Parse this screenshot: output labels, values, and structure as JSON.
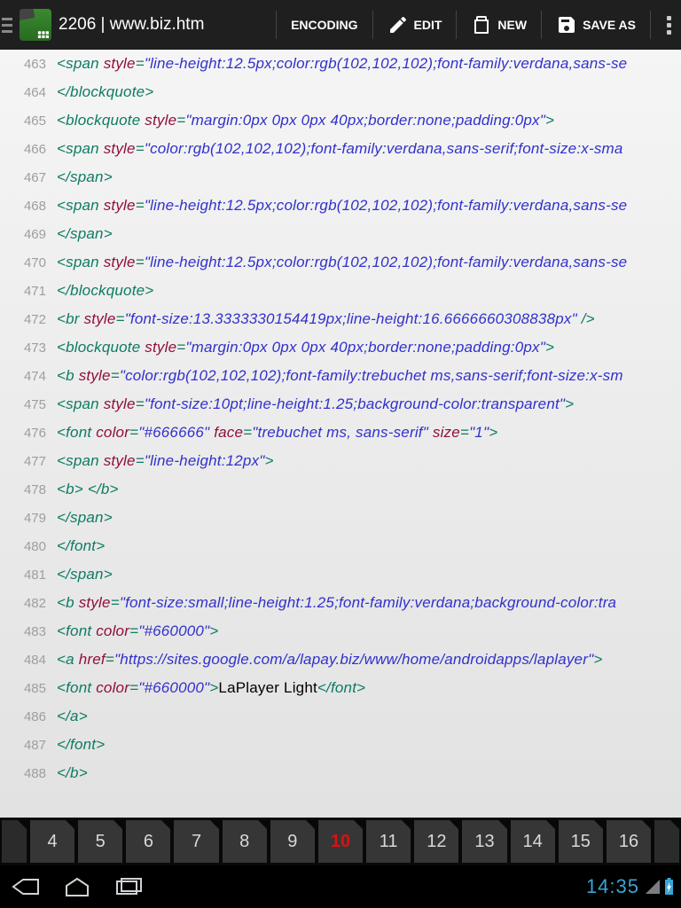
{
  "header": {
    "title": "2206 | www.biz.htm",
    "encoding": "ENCODING",
    "edit": "EDIT",
    "new": "NEW",
    "saveas": "SAVE AS"
  },
  "lines": [
    {
      "n": "463",
      "tokens": [
        {
          "c": "tag",
          "t": "<span "
        },
        {
          "c": "attr",
          "t": "style"
        },
        {
          "c": "tag",
          "t": "="
        },
        {
          "c": "val",
          "t": "\"line-height:12.5px;color:rgb(102,102,102);font-family:verdana,sans-se"
        }
      ]
    },
    {
      "n": "464",
      "tokens": [
        {
          "c": "tag",
          "t": "</blockquote>"
        }
      ]
    },
    {
      "n": "465",
      "tokens": [
        {
          "c": "tag",
          "t": "<blockquote "
        },
        {
          "c": "attr",
          "t": "style"
        },
        {
          "c": "tag",
          "t": "="
        },
        {
          "c": "val",
          "t": "\"margin:0px 0px 0px 40px;border:none;padding:0px\""
        },
        {
          "c": "tag",
          "t": ">"
        }
      ]
    },
    {
      "n": "466",
      "tokens": [
        {
          "c": "tag",
          "t": "<span "
        },
        {
          "c": "attr",
          "t": "style"
        },
        {
          "c": "tag",
          "t": "="
        },
        {
          "c": "val",
          "t": "\"color:rgb(102,102,102);font-family:verdana,sans-serif;font-size:x-sma"
        }
      ]
    },
    {
      "n": "467",
      "tokens": [
        {
          "c": "tag",
          "t": "</span>"
        }
      ]
    },
    {
      "n": "468",
      "tokens": [
        {
          "c": "tag",
          "t": "<span "
        },
        {
          "c": "attr",
          "t": "style"
        },
        {
          "c": "tag",
          "t": "="
        },
        {
          "c": "val",
          "t": "\"line-height:12.5px;color:rgb(102,102,102);font-family:verdana,sans-se"
        }
      ]
    },
    {
      "n": "469",
      "tokens": [
        {
          "c": "tag",
          "t": "</span>"
        }
      ]
    },
    {
      "n": "470",
      "tokens": [
        {
          "c": "tag",
          "t": "<span "
        },
        {
          "c": "attr",
          "t": "style"
        },
        {
          "c": "tag",
          "t": "="
        },
        {
          "c": "val",
          "t": "\"line-height:12.5px;color:rgb(102,102,102);font-family:verdana,sans-se"
        }
      ]
    },
    {
      "n": "471",
      "tokens": [
        {
          "c": "tag",
          "t": "</blockquote>"
        }
      ]
    },
    {
      "n": "472",
      "tokens": [
        {
          "c": "tag",
          "t": "<br "
        },
        {
          "c": "attr",
          "t": "style"
        },
        {
          "c": "tag",
          "t": "="
        },
        {
          "c": "val",
          "t": "\"font-size:13.3333330154419px;line-height:16.6666660308838px\""
        },
        {
          "c": "tag",
          "t": " />"
        }
      ]
    },
    {
      "n": "473",
      "tokens": [
        {
          "c": "tag",
          "t": "<blockquote "
        },
        {
          "c": "attr",
          "t": "style"
        },
        {
          "c": "tag",
          "t": "="
        },
        {
          "c": "val",
          "t": "\"margin:0px 0px 0px 40px;border:none;padding:0px\""
        },
        {
          "c": "tag",
          "t": ">"
        }
      ]
    },
    {
      "n": "474",
      "tokens": [
        {
          "c": "tag",
          "t": "<b "
        },
        {
          "c": "attr",
          "t": "style"
        },
        {
          "c": "tag",
          "t": "="
        },
        {
          "c": "val",
          "t": "\"color:rgb(102,102,102);font-family:trebuchet ms,sans-serif;font-size:x-sm"
        }
      ]
    },
    {
      "n": "475",
      "tokens": [
        {
          "c": "tag",
          "t": "<span "
        },
        {
          "c": "attr",
          "t": "style"
        },
        {
          "c": "tag",
          "t": "="
        },
        {
          "c": "val",
          "t": "\"font-size:10pt;line-height:1.25;background-color:transparent\""
        },
        {
          "c": "tag",
          "t": ">"
        }
      ]
    },
    {
      "n": "476",
      "tokens": [
        {
          "c": "tag",
          "t": "<font "
        },
        {
          "c": "attr",
          "t": "color"
        },
        {
          "c": "tag",
          "t": "="
        },
        {
          "c": "val",
          "t": "\"#666666\""
        },
        {
          "c": "attr",
          "t": " face"
        },
        {
          "c": "tag",
          "t": "="
        },
        {
          "c": "val",
          "t": "\"trebuchet ms, sans-serif\""
        },
        {
          "c": "attr",
          "t": " size"
        },
        {
          "c": "tag",
          "t": "="
        },
        {
          "c": "val",
          "t": "\"1\""
        },
        {
          "c": "tag",
          "t": ">"
        }
      ]
    },
    {
      "n": "477",
      "tokens": [
        {
          "c": "tag",
          "t": "<span "
        },
        {
          "c": "attr",
          "t": "style"
        },
        {
          "c": "tag",
          "t": "="
        },
        {
          "c": "val",
          "t": "\"line-height:12px\""
        },
        {
          "c": "tag",
          "t": ">"
        }
      ]
    },
    {
      "n": "478",
      "tokens": [
        {
          "c": "tag",
          "t": "<b> </b>"
        }
      ]
    },
    {
      "n": "479",
      "tokens": [
        {
          "c": "tag",
          "t": "</span>"
        }
      ]
    },
    {
      "n": "480",
      "tokens": [
        {
          "c": "tag",
          "t": "</font>"
        }
      ]
    },
    {
      "n": "481",
      "tokens": [
        {
          "c": "tag",
          "t": "</span>"
        }
      ]
    },
    {
      "n": "482",
      "tokens": [
        {
          "c": "tag",
          "t": "<b "
        },
        {
          "c": "attr",
          "t": "style"
        },
        {
          "c": "tag",
          "t": "="
        },
        {
          "c": "val",
          "t": "\"font-size:small;line-height:1.25;font-family:verdana;background-color:tra"
        }
      ]
    },
    {
      "n": "483",
      "tokens": [
        {
          "c": "tag",
          "t": "<font "
        },
        {
          "c": "attr",
          "t": "color"
        },
        {
          "c": "tag",
          "t": "="
        },
        {
          "c": "val",
          "t": "\"#660000\""
        },
        {
          "c": "tag",
          "t": ">"
        }
      ]
    },
    {
      "n": "484",
      "tokens": [
        {
          "c": "tag",
          "t": "<a "
        },
        {
          "c": "attr",
          "t": "href"
        },
        {
          "c": "tag",
          "t": "="
        },
        {
          "c": "val",
          "t": "\"https://sites.google.com/a/lapay.biz/www/home/androidapps/laplayer\""
        },
        {
          "c": "tag",
          "t": ">"
        }
      ]
    },
    {
      "n": "485",
      "tokens": [
        {
          "c": "tag",
          "t": "<font "
        },
        {
          "c": "attr",
          "t": "color"
        },
        {
          "c": "tag",
          "t": "="
        },
        {
          "c": "val",
          "t": "\"#660000\""
        },
        {
          "c": "tag",
          "t": ">"
        },
        {
          "c": "txt",
          "t": "LaPlayer Light"
        },
        {
          "c": "tag",
          "t": "</font>"
        }
      ]
    },
    {
      "n": "486",
      "tokens": [
        {
          "c": "tag",
          "t": "</a>"
        }
      ]
    },
    {
      "n": "487",
      "tokens": [
        {
          "c": "tag",
          "t": "</font>"
        }
      ]
    },
    {
      "n": "488",
      "tokens": [
        {
          "c": "tag",
          "t": "</b>"
        }
      ]
    }
  ],
  "tabs": [
    "4",
    "5",
    "6",
    "7",
    "8",
    "9",
    "10",
    "11",
    "12",
    "13",
    "14",
    "15",
    "16"
  ],
  "activeTab": "10",
  "statusbar": {
    "time": "14:35"
  }
}
